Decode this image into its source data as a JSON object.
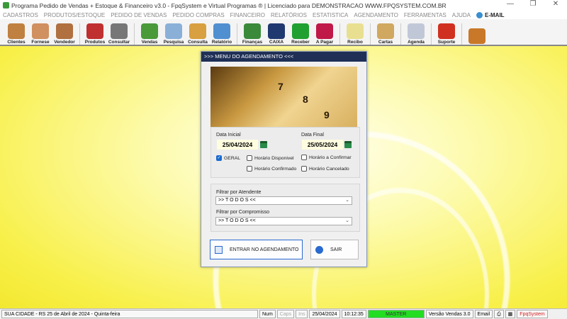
{
  "window": {
    "title": "Programa Pedido de Vendas + Estoque & Financeiro v3.0 - FpqSystem e Virtual Programas ® | Licenciado para  DEMONSTRACAO WWW.FPQSYSTEM.COM.BR"
  },
  "menu": [
    "CADASTROS",
    "PRODUTOS/ESTOQUE",
    "PEDIDO DE VENDAS",
    "PEDIDO COMPRAS",
    "FINANCEIRO",
    "RELATÓRIOS",
    "ESTATISTICA",
    "AGENDAMENTO",
    "FERRAMENTAS",
    "AJUDA"
  ],
  "menu_email": "E-MAIL",
  "toolbar": [
    {
      "label": "Clientes",
      "color": "#c08040"
    },
    {
      "label": "Fornese",
      "color": "#d09060"
    },
    {
      "label": "Vendedor",
      "color": "#b07040"
    },
    {
      "label": "Produtos",
      "color": "#c03030"
    },
    {
      "label": "Consultar",
      "color": "#777777"
    },
    {
      "label": "Vendas",
      "color": "#4a9a3a"
    },
    {
      "label": "Pesquisa",
      "color": "#8ab0d8"
    },
    {
      "label": "Consulta",
      "color": "#d8a040"
    },
    {
      "label": "Relatório",
      "color": "#5090d0"
    },
    {
      "label": "Finanças",
      "color": "#3a8a3a"
    },
    {
      "label": "CAIXA",
      "color": "#203870"
    },
    {
      "label": "Receber",
      "color": "#20a030"
    },
    {
      "label": "A Pagar",
      "color": "#c01848"
    },
    {
      "label": "Recibo",
      "color": "#e8e090"
    },
    {
      "label": "Cartas",
      "color": "#d0a860"
    },
    {
      "label": "Agenda",
      "color": "#c0c8d8"
    },
    {
      "label": "Suporte",
      "color": "#d03020"
    },
    {
      "label": "",
      "color": "#c87828"
    }
  ],
  "dialog": {
    "title": ">>>  MENU DO AGENDAMENTO  <<<",
    "banner_numbers": [
      "7",
      "8",
      "9"
    ],
    "date_start_label": "Data Inicial",
    "date_start": "25/04/2024",
    "date_end_label": "Data Final",
    "date_end": "25/05/2024",
    "checks": {
      "geral": "GERAL",
      "disponivel": "Horário  Disponivel",
      "confirmar": "Horário a Confirmar",
      "confirmado": "Horário Confirmado",
      "cancelado": "Horário Cancelado"
    },
    "filter_atendente_label": "Filtrar por Atendente",
    "filter_atendente": ">> T O D O S <<",
    "filter_compromisso_label": "Filtrar por Compromisso",
    "filter_compromisso": ">> T O D O S <<",
    "enter_button": "ENTRAR NO AGENDAMENTO",
    "exit_button": "SAIR"
  },
  "status": {
    "city": "SUA CIDADE - RS 25 de Abril de 2024 - Quinta-feira",
    "num": "Num",
    "caps": "Caps",
    "ins": "Ins",
    "date": "25/04/2024",
    "time": "10:12:35",
    "user": "MASTER",
    "version": "Versão Vendas 3.0",
    "email": "Email",
    "brand": "FpqSystem"
  }
}
